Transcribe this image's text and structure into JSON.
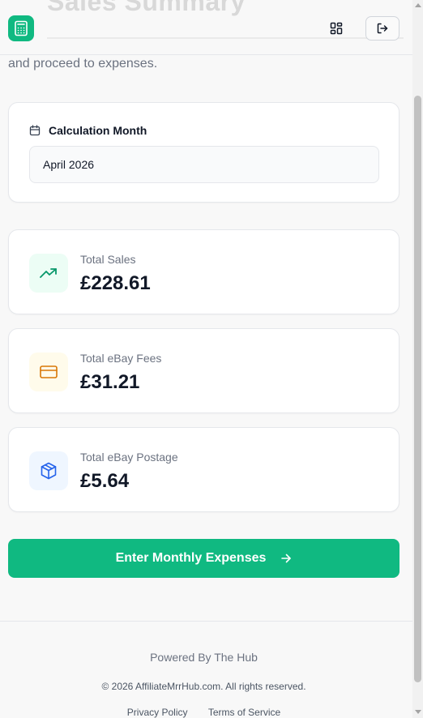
{
  "header": {
    "background_title": "Sales Summary",
    "logo_icon": "calculator-icon",
    "grid_icon": "grid-icon",
    "logout_icon": "logout-icon"
  },
  "intro_text": "and proceed to expenses.",
  "month_card": {
    "label": "Calculation Month",
    "icon": "calendar-icon",
    "value": "April 2026"
  },
  "stats": [
    {
      "label": "Total Sales",
      "value": "£228.61",
      "icon": "trending-up-icon",
      "icon_color": "#059669",
      "icon_bg": "#ecfdf5"
    },
    {
      "label": "Total eBay Fees",
      "value": "£31.21",
      "icon": "credit-card-icon",
      "icon_color": "#d97706",
      "icon_bg": "#fffbeb"
    },
    {
      "label": "Total eBay Postage",
      "value": "£5.64",
      "icon": "package-icon",
      "icon_color": "#2563eb",
      "icon_bg": "#eff6ff"
    }
  ],
  "cta": {
    "label": "Enter Monthly Expenses",
    "icon": "arrow-right-icon"
  },
  "footer": {
    "powered": "Powered By The Hub",
    "copyright": "© 2026 AffiliateMrrHub.com. All rights reserved.",
    "privacy": "Privacy Policy",
    "terms": "Terms of Service"
  },
  "colors": {
    "accent": "#10b981"
  }
}
